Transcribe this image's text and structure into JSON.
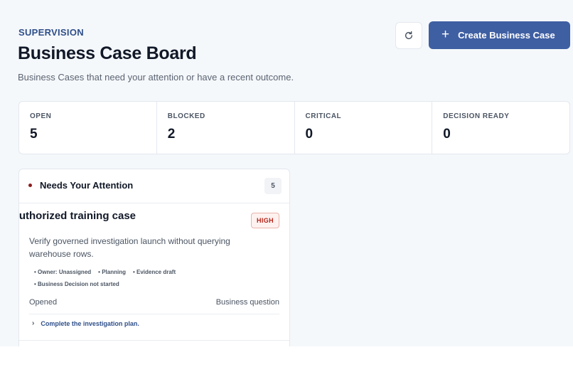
{
  "header": {
    "eyebrow": "SUPERVISION",
    "title": "Business Case Board",
    "subtitle": "Business Cases that need your attention or have a recent outcome.",
    "refresh_icon": "refresh-icon",
    "create_label": "Create Business Case",
    "create_icon": "plus-icon",
    "accent_color": "#3f5fa3"
  },
  "stats": [
    {
      "label": "OPEN",
      "value": "5"
    },
    {
      "label": "BLOCKED",
      "value": "2"
    },
    {
      "label": "CRITICAL",
      "value": "0"
    },
    {
      "label": "DECISION READY",
      "value": "0"
    }
  ],
  "attention": {
    "title": "Needs Your Attention",
    "count": "5",
    "dot_color": "#8b1d1d",
    "cases": [
      {
        "title": "Authorized training case",
        "priority": "HIGH",
        "description": "Verify governed investigation launch without querying warehouse rows.",
        "meta_line1": [
          "Owner: Unassigned",
          "Planning",
          "Evidence draft"
        ],
        "meta_line2": [
          "Business Decision not started"
        ],
        "status": "Opened",
        "type": "Business question",
        "next_step": "Complete the investigation plan."
      }
    ]
  }
}
